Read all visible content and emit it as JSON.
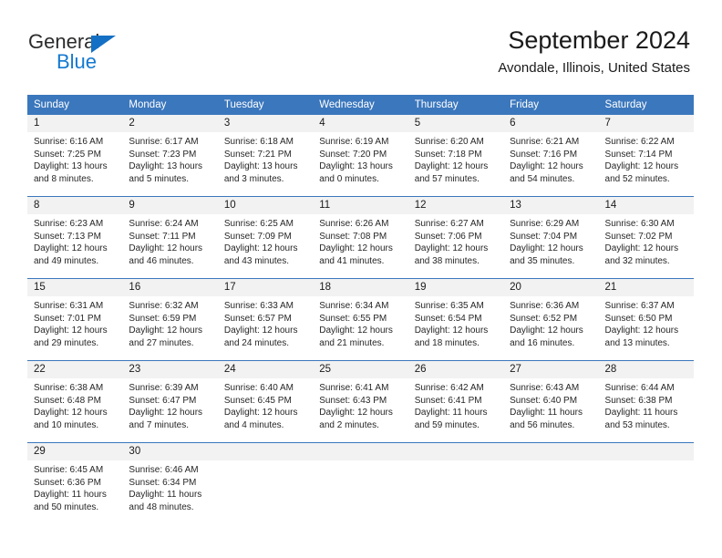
{
  "brand": {
    "name_top": "General",
    "name_bottom": "Blue",
    "colors": {
      "header_blue": "#3b77bd",
      "logo_blue": "#1479d0",
      "daynum_bg": "#f2f2f2"
    }
  },
  "header": {
    "title": "September 2024",
    "subtitle": "Avondale, Illinois, United States"
  },
  "weekday_headers": [
    "Sunday",
    "Monday",
    "Tuesday",
    "Wednesday",
    "Thursday",
    "Friday",
    "Saturday"
  ],
  "weeks": [
    [
      {
        "day": "1",
        "sunrise": "Sunrise: 6:16 AM",
        "sunset": "Sunset: 7:25 PM",
        "daylight_line1": "Daylight: 13 hours",
        "daylight_line2": "and 8 minutes."
      },
      {
        "day": "2",
        "sunrise": "Sunrise: 6:17 AM",
        "sunset": "Sunset: 7:23 PM",
        "daylight_line1": "Daylight: 13 hours",
        "daylight_line2": "and 5 minutes."
      },
      {
        "day": "3",
        "sunrise": "Sunrise: 6:18 AM",
        "sunset": "Sunset: 7:21 PM",
        "daylight_line1": "Daylight: 13 hours",
        "daylight_line2": "and 3 minutes."
      },
      {
        "day": "4",
        "sunrise": "Sunrise: 6:19 AM",
        "sunset": "Sunset: 7:20 PM",
        "daylight_line1": "Daylight: 13 hours",
        "daylight_line2": "and 0 minutes."
      },
      {
        "day": "5",
        "sunrise": "Sunrise: 6:20 AM",
        "sunset": "Sunset: 7:18 PM",
        "daylight_line1": "Daylight: 12 hours",
        "daylight_line2": "and 57 minutes."
      },
      {
        "day": "6",
        "sunrise": "Sunrise: 6:21 AM",
        "sunset": "Sunset: 7:16 PM",
        "daylight_line1": "Daylight: 12 hours",
        "daylight_line2": "and 54 minutes."
      },
      {
        "day": "7",
        "sunrise": "Sunrise: 6:22 AM",
        "sunset": "Sunset: 7:14 PM",
        "daylight_line1": "Daylight: 12 hours",
        "daylight_line2": "and 52 minutes."
      }
    ],
    [
      {
        "day": "8",
        "sunrise": "Sunrise: 6:23 AM",
        "sunset": "Sunset: 7:13 PM",
        "daylight_line1": "Daylight: 12 hours",
        "daylight_line2": "and 49 minutes."
      },
      {
        "day": "9",
        "sunrise": "Sunrise: 6:24 AM",
        "sunset": "Sunset: 7:11 PM",
        "daylight_line1": "Daylight: 12 hours",
        "daylight_line2": "and 46 minutes."
      },
      {
        "day": "10",
        "sunrise": "Sunrise: 6:25 AM",
        "sunset": "Sunset: 7:09 PM",
        "daylight_line1": "Daylight: 12 hours",
        "daylight_line2": "and 43 minutes."
      },
      {
        "day": "11",
        "sunrise": "Sunrise: 6:26 AM",
        "sunset": "Sunset: 7:08 PM",
        "daylight_line1": "Daylight: 12 hours",
        "daylight_line2": "and 41 minutes."
      },
      {
        "day": "12",
        "sunrise": "Sunrise: 6:27 AM",
        "sunset": "Sunset: 7:06 PM",
        "daylight_line1": "Daylight: 12 hours",
        "daylight_line2": "and 38 minutes."
      },
      {
        "day": "13",
        "sunrise": "Sunrise: 6:29 AM",
        "sunset": "Sunset: 7:04 PM",
        "daylight_line1": "Daylight: 12 hours",
        "daylight_line2": "and 35 minutes."
      },
      {
        "day": "14",
        "sunrise": "Sunrise: 6:30 AM",
        "sunset": "Sunset: 7:02 PM",
        "daylight_line1": "Daylight: 12 hours",
        "daylight_line2": "and 32 minutes."
      }
    ],
    [
      {
        "day": "15",
        "sunrise": "Sunrise: 6:31 AM",
        "sunset": "Sunset: 7:01 PM",
        "daylight_line1": "Daylight: 12 hours",
        "daylight_line2": "and 29 minutes."
      },
      {
        "day": "16",
        "sunrise": "Sunrise: 6:32 AM",
        "sunset": "Sunset: 6:59 PM",
        "daylight_line1": "Daylight: 12 hours",
        "daylight_line2": "and 27 minutes."
      },
      {
        "day": "17",
        "sunrise": "Sunrise: 6:33 AM",
        "sunset": "Sunset: 6:57 PM",
        "daylight_line1": "Daylight: 12 hours",
        "daylight_line2": "and 24 minutes."
      },
      {
        "day": "18",
        "sunrise": "Sunrise: 6:34 AM",
        "sunset": "Sunset: 6:55 PM",
        "daylight_line1": "Daylight: 12 hours",
        "daylight_line2": "and 21 minutes."
      },
      {
        "day": "19",
        "sunrise": "Sunrise: 6:35 AM",
        "sunset": "Sunset: 6:54 PM",
        "daylight_line1": "Daylight: 12 hours",
        "daylight_line2": "and 18 minutes."
      },
      {
        "day": "20",
        "sunrise": "Sunrise: 6:36 AM",
        "sunset": "Sunset: 6:52 PM",
        "daylight_line1": "Daylight: 12 hours",
        "daylight_line2": "and 16 minutes."
      },
      {
        "day": "21",
        "sunrise": "Sunrise: 6:37 AM",
        "sunset": "Sunset: 6:50 PM",
        "daylight_line1": "Daylight: 12 hours",
        "daylight_line2": "and 13 minutes."
      }
    ],
    [
      {
        "day": "22",
        "sunrise": "Sunrise: 6:38 AM",
        "sunset": "Sunset: 6:48 PM",
        "daylight_line1": "Daylight: 12 hours",
        "daylight_line2": "and 10 minutes."
      },
      {
        "day": "23",
        "sunrise": "Sunrise: 6:39 AM",
        "sunset": "Sunset: 6:47 PM",
        "daylight_line1": "Daylight: 12 hours",
        "daylight_line2": "and 7 minutes."
      },
      {
        "day": "24",
        "sunrise": "Sunrise: 6:40 AM",
        "sunset": "Sunset: 6:45 PM",
        "daylight_line1": "Daylight: 12 hours",
        "daylight_line2": "and 4 minutes."
      },
      {
        "day": "25",
        "sunrise": "Sunrise: 6:41 AM",
        "sunset": "Sunset: 6:43 PM",
        "daylight_line1": "Daylight: 12 hours",
        "daylight_line2": "and 2 minutes."
      },
      {
        "day": "26",
        "sunrise": "Sunrise: 6:42 AM",
        "sunset": "Sunset: 6:41 PM",
        "daylight_line1": "Daylight: 11 hours",
        "daylight_line2": "and 59 minutes."
      },
      {
        "day": "27",
        "sunrise": "Sunrise: 6:43 AM",
        "sunset": "Sunset: 6:40 PM",
        "daylight_line1": "Daylight: 11 hours",
        "daylight_line2": "and 56 minutes."
      },
      {
        "day": "28",
        "sunrise": "Sunrise: 6:44 AM",
        "sunset": "Sunset: 6:38 PM",
        "daylight_line1": "Daylight: 11 hours",
        "daylight_line2": "and 53 minutes."
      }
    ],
    [
      {
        "day": "29",
        "sunrise": "Sunrise: 6:45 AM",
        "sunset": "Sunset: 6:36 PM",
        "daylight_line1": "Daylight: 11 hours",
        "daylight_line2": "and 50 minutes."
      },
      {
        "day": "30",
        "sunrise": "Sunrise: 6:46 AM",
        "sunset": "Sunset: 6:34 PM",
        "daylight_line1": "Daylight: 11 hours",
        "daylight_line2": "and 48 minutes."
      },
      {
        "day": "",
        "sunrise": "",
        "sunset": "",
        "daylight_line1": "",
        "daylight_line2": ""
      },
      {
        "day": "",
        "sunrise": "",
        "sunset": "",
        "daylight_line1": "",
        "daylight_line2": ""
      },
      {
        "day": "",
        "sunrise": "",
        "sunset": "",
        "daylight_line1": "",
        "daylight_line2": ""
      },
      {
        "day": "",
        "sunrise": "",
        "sunset": "",
        "daylight_line1": "",
        "daylight_line2": ""
      },
      {
        "day": "",
        "sunrise": "",
        "sunset": "",
        "daylight_line1": "",
        "daylight_line2": ""
      }
    ]
  ]
}
